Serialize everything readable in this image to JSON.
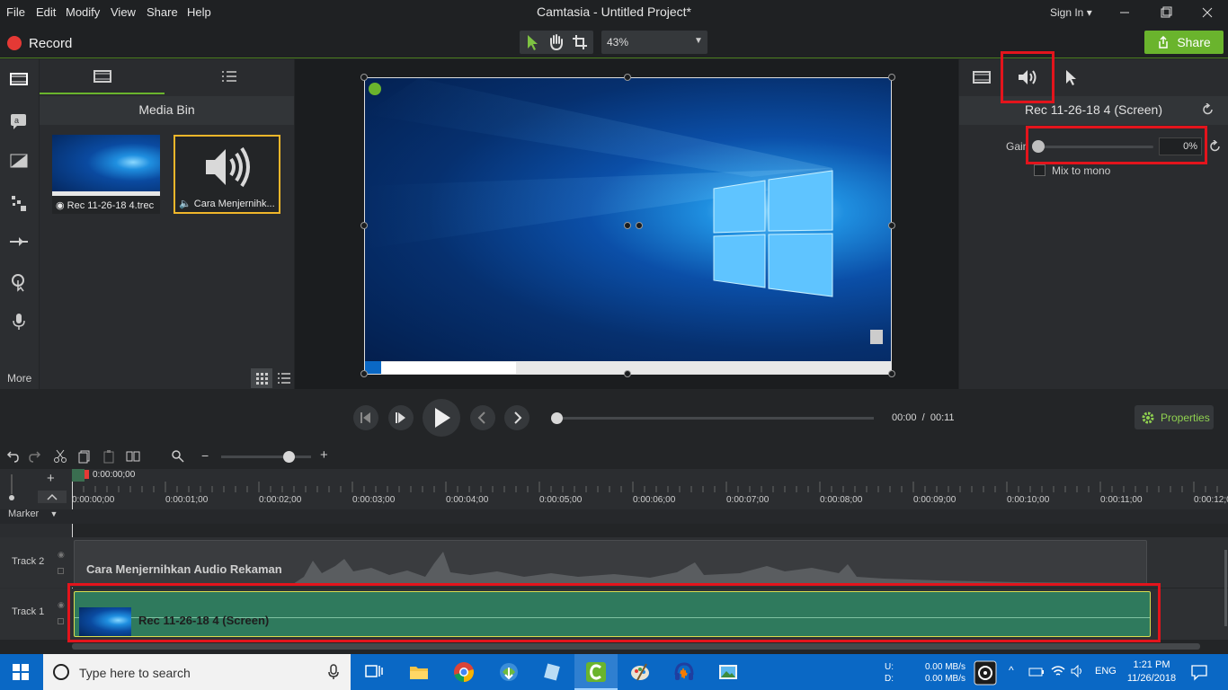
{
  "menu": [
    "File",
    "Edit",
    "Modify",
    "View",
    "Share",
    "Help"
  ],
  "app_title": "Camtasia - Untitled Project*",
  "sign_in": "Sign In",
  "toolbar": {
    "record_label": "Record",
    "zoom_value": "43%",
    "share_label": "Share"
  },
  "rail": {
    "more_label": "More"
  },
  "media_bin": {
    "title": "Media Bin",
    "items": [
      {
        "label": "Rec 11-26-18 4.trec",
        "icon": "record-icon"
      },
      {
        "label": "Cara Menjernihk...",
        "icon": "speaker-icon"
      }
    ]
  },
  "properties": {
    "title": "Rec 11-26-18 4 (Screen)",
    "gain_label": "Gain",
    "gain_value": "0%",
    "mix_mono_label": "Mix to mono",
    "gain_level": 0
  },
  "playback": {
    "current_time": "00:00",
    "separator": "/",
    "total_time": "00:11",
    "properties_label": "Properties"
  },
  "timeline": {
    "playhead_time": "0:00:00;00",
    "marker_label": "Marker",
    "ticks": [
      "0:00:00;00",
      "0:00:01;00",
      "0:00:02;00",
      "0:00:03;00",
      "0:00:04;00",
      "0:00:05;00",
      "0:00:06;00",
      "0:00:07;00",
      "0:00:08;00",
      "0:00:09;00",
      "0:00:10;00",
      "0:00:11;00",
      "0:00:12;0"
    ],
    "tracks": [
      {
        "name": "Track 2",
        "clip": "Cara Menjernihkan Audio Rekaman"
      },
      {
        "name": "Track 1",
        "clip": "Rec 11-26-18 4 (Screen)"
      }
    ]
  },
  "taskbar": {
    "search_placeholder": "Type here to search",
    "net_labels": [
      "U:",
      "D:"
    ],
    "net_values": [
      "0.00 MB/s",
      "0.00 MB/s"
    ],
    "language": "ENG",
    "time": "1:21 PM",
    "date": "11/26/2018"
  },
  "colors": {
    "accent": "#6ab42d",
    "highlight": "#e3141c",
    "record": "#e53935",
    "clip_video": "#2f7a5d",
    "taskbar": "#0a68c5"
  }
}
